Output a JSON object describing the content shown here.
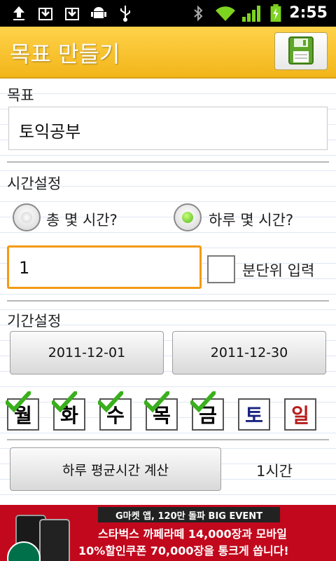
{
  "status_bar": {
    "time": "2:55",
    "icons": [
      "upload-icon",
      "download-icon",
      "download-icon",
      "android-icon",
      "usb-icon",
      "bluetooth-icon",
      "wifi-icon",
      "signal-icon",
      "battery-charging-icon"
    ]
  },
  "header": {
    "title": "목표 만들기",
    "save_icon": "floppy-disk-icon",
    "accent": "#f2b51a"
  },
  "goal": {
    "label": "목표",
    "value": "토익공부"
  },
  "time_setting": {
    "label": "시간설정",
    "options": [
      {
        "label": "총 몇 시간?",
        "selected": false
      },
      {
        "label": "하루 몇 시간?",
        "selected": true
      }
    ],
    "hours_value": "1",
    "minute_unit_label": "분단위 입력",
    "minute_unit_checked": false,
    "focus_color": "#f39a16"
  },
  "period": {
    "label": "기간설정",
    "start_date": "2011-12-01",
    "end_date": "2011-12-30"
  },
  "days": [
    {
      "label": "월",
      "checked": true,
      "color": "#111111"
    },
    {
      "label": "화",
      "checked": true,
      "color": "#111111"
    },
    {
      "label": "수",
      "checked": true,
      "color": "#111111"
    },
    {
      "label": "목",
      "checked": true,
      "color": "#111111"
    },
    {
      "label": "금",
      "checked": true,
      "color": "#111111"
    },
    {
      "label": "토",
      "checked": false,
      "color": "#1a237e"
    },
    {
      "label": "일",
      "checked": false,
      "color": "#b71c1c"
    }
  ],
  "average": {
    "button_label": "하루 평균시간 계산",
    "result": "1시간"
  },
  "ad": {
    "headline": "G마켓 앱, 120만 돌파 BIG EVENT",
    "line1": "스타벅스 까페라떼 14,000장과 모바일",
    "line2": "10%할인쿠폰 70,000장을 통크게 쏩니다!"
  }
}
